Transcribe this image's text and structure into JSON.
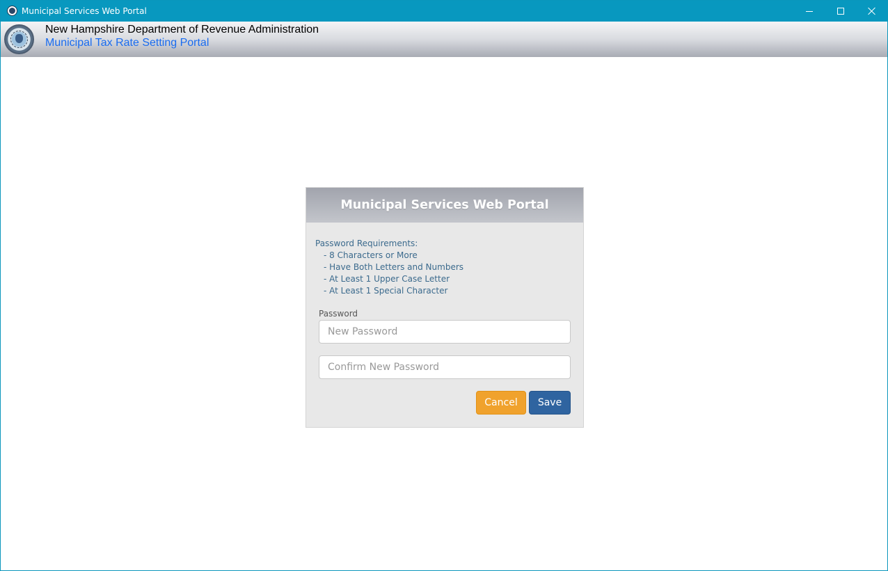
{
  "window": {
    "title": "Municipal Services Web Portal"
  },
  "header": {
    "department": "New Hampshire Department of Revenue Administration",
    "portal": "Municipal Tax Rate Setting Portal"
  },
  "panel": {
    "title": "Municipal Services Web Portal",
    "requirements_heading": "Password Requirements:",
    "requirements": [
      "- 8 Characters or More",
      "- Have Both Letters and Numbers",
      "- At Least 1 Upper Case Letter",
      "- At Least 1 Special Character"
    ],
    "password_label": "Password",
    "new_password": {
      "value": "",
      "placeholder": "New Password"
    },
    "confirm_password": {
      "value": "",
      "placeholder": "Confirm New Password"
    },
    "cancel_label": "Cancel",
    "save_label": "Save"
  },
  "colors": {
    "titlebar": "#0898bf",
    "portal_link": "#1a6cf0",
    "cancel": "#f0a22d",
    "save": "#2f64a0"
  },
  "icons": {
    "app_icon": "seal-icon",
    "minimize": "minimize-icon",
    "maximize": "maximize-icon",
    "close": "close-icon"
  }
}
